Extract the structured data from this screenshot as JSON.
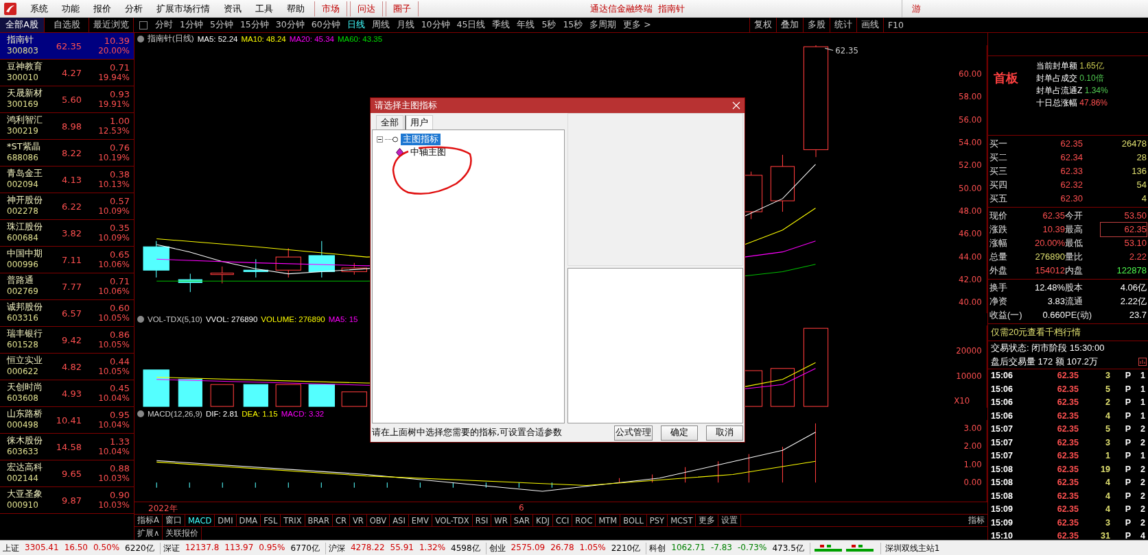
{
  "menu_bar": {
    "items": [
      "系统",
      "功能",
      "报价",
      "分析",
      "扩展市场行情",
      "资讯",
      "工具",
      "帮助"
    ],
    "quick_buttons": [
      "市场",
      "问达",
      "圈子"
    ],
    "title": "通达信金融终端  指南针",
    "right_button": "游"
  },
  "list_tabs": [
    {
      "label": "全部A股",
      "selected": true
    },
    {
      "label": "自选股",
      "selected": false
    },
    {
      "label": "最近浏览",
      "selected": false
    }
  ],
  "period_tabs": [
    {
      "label": "分时",
      "selected": false
    },
    {
      "label": "1分钟",
      "selected": false
    },
    {
      "label": "5分钟",
      "selected": false
    },
    {
      "label": "15分钟",
      "selected": false
    },
    {
      "label": "30分钟",
      "selected": false
    },
    {
      "label": "60分钟",
      "selected": false
    },
    {
      "label": "日线",
      "selected": true
    },
    {
      "label": "周线",
      "selected": false
    },
    {
      "label": "月线",
      "selected": false
    },
    {
      "label": "10分钟",
      "selected": false
    },
    {
      "label": "45日线",
      "selected": false
    },
    {
      "label": "季线",
      "selected": false
    },
    {
      "label": "年线",
      "selected": false
    },
    {
      "label": "5秒",
      "selected": false
    },
    {
      "label": "15秒",
      "selected": false
    },
    {
      "label": "多周期",
      "selected": false
    },
    {
      "label": "更多 >",
      "selected": false
    }
  ],
  "tool_buttons": [
    "复权",
    "叠加",
    "多股",
    "统计",
    "画线",
    "F10"
  ],
  "stocks": [
    {
      "name": "指南针",
      "code": "300803",
      "price": "62.35",
      "change": "10.39",
      "pct": "20.00%",
      "selected": true
    },
    {
      "name": "豆神教育",
      "code": "300010",
      "price": "4.27",
      "change": "0.71",
      "pct": "19.94%",
      "selected": false
    },
    {
      "name": "天晟新材",
      "code": "300169",
      "price": "5.60",
      "change": "0.93",
      "pct": "19.91%",
      "selected": false
    },
    {
      "name": "鸿利智汇",
      "code": "300219",
      "price": "8.98",
      "change": "1.00",
      "pct": "12.53%",
      "selected": false
    },
    {
      "name": "*ST紫晶",
      "code": "688086",
      "price": "8.22",
      "change": "0.76",
      "pct": "10.19%",
      "selected": false
    },
    {
      "name": "青岛金王",
      "code": "002094",
      "price": "4.13",
      "change": "0.38",
      "pct": "10.13%",
      "selected": false
    },
    {
      "name": "神开股份",
      "code": "002278",
      "price": "6.22",
      "change": "0.57",
      "pct": "10.09%",
      "selected": false
    },
    {
      "name": "珠江股份",
      "code": "600684",
      "price": "3.82",
      "change": "0.35",
      "pct": "10.09%",
      "selected": false
    },
    {
      "name": "中国中期",
      "code": "000996",
      "price": "7.11",
      "change": "0.65",
      "pct": "10.06%",
      "selected": false
    },
    {
      "name": "普路通",
      "code": "002769",
      "price": "7.77",
      "change": "0.71",
      "pct": "10.06%",
      "selected": false
    },
    {
      "name": "诚邦股份",
      "code": "603316",
      "price": "6.57",
      "change": "0.60",
      "pct": "10.05%",
      "selected": false
    },
    {
      "name": "瑞丰银行",
      "code": "601528",
      "price": "9.42",
      "change": "0.86",
      "pct": "10.05%",
      "selected": false
    },
    {
      "name": "恒立实业",
      "code": "000622",
      "price": "4.82",
      "change": "0.44",
      "pct": "10.05%",
      "selected": false
    },
    {
      "name": "天创时尚",
      "code": "603608",
      "price": "4.93",
      "change": "0.45",
      "pct": "10.04%",
      "selected": false
    },
    {
      "name": "山东路桥",
      "code": "000498",
      "price": "10.41",
      "change": "0.95",
      "pct": "10.04%",
      "selected": false
    },
    {
      "name": "徕木股份",
      "code": "603633",
      "price": "14.58",
      "change": "1.33",
      "pct": "10.04%",
      "selected": false
    },
    {
      "name": "宏达高科",
      "code": "002144",
      "price": "9.65",
      "change": "0.88",
      "pct": "10.03%",
      "selected": false
    },
    {
      "name": "大亚圣象",
      "code": "000910",
      "price": "9.87",
      "change": "0.90",
      "pct": "10.03%",
      "selected": false
    }
  ],
  "chart": {
    "main_header": [
      {
        "text": "指南针(日线)"
      },
      {
        "text": "MA5: 52.24",
        "color": "#ffffff"
      },
      {
        "text": "MA10: 48.24",
        "color": "#ffff00"
      },
      {
        "text": "MA20: 45.34",
        "color": "#ff00ff"
      },
      {
        "text": "MA60: 43.35",
        "color": "#00e000"
      }
    ],
    "price_labels": [
      "60.00",
      "58.00",
      "56.00",
      "54.00",
      "52.00",
      "50.00",
      "48.00",
      "46.00",
      "44.00",
      "42.00",
      "40.00"
    ],
    "high_label": "62.35",
    "volume_header": [
      {
        "text": "VOL-TDX(5,10)"
      },
      {
        "text": "VVOL: 276890",
        "color": "#ffffff"
      },
      {
        "text": "VOLUME: 276890",
        "color": "#ffff00"
      },
      {
        "text": "MA5: 15",
        "color": "#ff00ff"
      }
    ],
    "volume_labels": [
      "20000",
      "10000",
      "X10"
    ],
    "macd_header": [
      {
        "text": "MACD(12,26,9)"
      },
      {
        "text": "DIF: 2.81",
        "color": "#ffffff"
      },
      {
        "text": "DEA: 1.15",
        "color": "#ffff00"
      },
      {
        "text": "MACD: 3.32",
        "color": "#ff00ff"
      }
    ],
    "macd_labels": [
      "3.00",
      "2.00",
      "1.00",
      "0.00"
    ],
    "date_labels": [
      "2022年",
      "6"
    ]
  },
  "indicator_tabs": [
    {
      "label": "指标A",
      "selected": false
    },
    {
      "label": "窗口",
      "selected": false
    },
    {
      "label": "MACD",
      "selected": true
    },
    {
      "label": "DMI",
      "selected": false
    },
    {
      "label": "DMA",
      "selected": false
    },
    {
      "label": "FSL",
      "selected": false
    },
    {
      "label": "TRIX",
      "selected": false
    },
    {
      "label": "BRAR",
      "selected": false
    },
    {
      "label": "CR",
      "selected": false
    },
    {
      "label": "VR",
      "selected": false
    },
    {
      "label": "OBV",
      "selected": false
    },
    {
      "label": "ASI",
      "selected": false
    },
    {
      "label": "EMV",
      "selected": false
    },
    {
      "label": "VOL-TDX",
      "selected": false
    },
    {
      "label": "RSI",
      "selected": false
    },
    {
      "label": "WR",
      "selected": false
    },
    {
      "label": "SAR",
      "selected": false
    },
    {
      "label": "KDJ",
      "selected": false
    },
    {
      "label": "CCI",
      "selected": false
    },
    {
      "label": "ROC",
      "selected": false
    },
    {
      "label": "MTM",
      "selected": false
    },
    {
      "label": "BOLL",
      "selected": false
    },
    {
      "label": "PSY",
      "selected": false
    },
    {
      "label": "MCST",
      "selected": false
    },
    {
      "label": "更多",
      "selected": false
    },
    {
      "label": "设置",
      "selected": false
    }
  ],
  "indicator_right": "指标",
  "extension_tabs": [
    "扩展∧",
    "关联报价"
  ],
  "dialog": {
    "title": "请选择主图指标",
    "tabs": [
      {
        "label": "全部",
        "selected": false
      },
      {
        "label": "用户",
        "selected": true
      }
    ],
    "tree": [
      {
        "label": "主图指标",
        "expanded": true,
        "selected": true,
        "children": [
          {
            "label": "中轴主图",
            "selected": false
          }
        ]
      }
    ],
    "hint": "请在上面树中选择您需要的指标,可设置合适参数",
    "buttons": [
      "公式管理",
      "确定",
      "取消"
    ]
  },
  "quote": {
    "badge": "首板",
    "seal_info": [
      {
        "label": "当前封单额",
        "value": "1.65亿",
        "color": "#c8c850"
      },
      {
        "label": "封单占成交",
        "value": "0.10倍",
        "color": "#50c850"
      },
      {
        "label": "封单占流通Z",
        "value": "1.34%",
        "color": "#50c850"
      },
      {
        "label": "十日总涨幅",
        "value": "47.86%",
        "color": "#ff5050"
      }
    ],
    "bids": [
      {
        "label": "买一",
        "price": "62.35",
        "volume": "26478"
      },
      {
        "label": "买二",
        "price": "62.34",
        "volume": "28"
      },
      {
        "label": "买三",
        "price": "62.33",
        "volume": "136"
      },
      {
        "label": "买四",
        "price": "62.32",
        "volume": "54"
      },
      {
        "label": "买五",
        "price": "62.30",
        "volume": "4"
      }
    ],
    "stats": [
      {
        "label": "现价",
        "value": "62.35",
        "color": "#ff5050"
      },
      {
        "label": "今开",
        "value": "53.50",
        "color": "#ff5050"
      },
      {
        "label": "涨跌",
        "value": "10.39",
        "color": "#ff5050"
      },
      {
        "label": "最高",
        "value": "62.35",
        "color": "#ff5050"
      },
      {
        "label": "涨幅",
        "value": "20.00%",
        "color": "#ff5050"
      },
      {
        "label": "最低",
        "value": "53.10",
        "color": "#ff5050"
      },
      {
        "label": "总量",
        "value": "276890",
        "color": "#e0e070"
      },
      {
        "label": "量比",
        "value": "2.22",
        "color": "#ff5050"
      },
      {
        "label": "外盘",
        "value": "154012",
        "color": "#ff5050"
      },
      {
        "label": "内盘",
        "value": "122878",
        "color": "#50ff50"
      }
    ],
    "finance": [
      {
        "label": "换手",
        "value": "12.48%"
      },
      {
        "label": "股本",
        "value": "4.06亿"
      },
      {
        "label": "净资",
        "value": "3.83"
      },
      {
        "label": "流通",
        "value": "2.22亿"
      },
      {
        "label": "收益(一)",
        "value": "0.660"
      },
      {
        "label": "PE(动)",
        "value": "23.7"
      }
    ],
    "promo": "仅需20元查看千档行情",
    "status_line": "交易状态: 闭市阶段 15:30:00",
    "after_hours": "盘后交易量 172 额 107.2万",
    "ticks": [
      {
        "time": "15:06",
        "price": "62.35",
        "volume": "3",
        "flag": "P",
        "count": "1"
      },
      {
        "time": "15:06",
        "price": "62.35",
        "volume": "5",
        "flag": "P",
        "count": "1"
      },
      {
        "time": "15:06",
        "price": "62.35",
        "volume": "2",
        "flag": "P",
        "count": "1"
      },
      {
        "time": "15:06",
        "price": "62.35",
        "volume": "4",
        "flag": "P",
        "count": "1"
      },
      {
        "time": "15:07",
        "price": "62.35",
        "volume": "5",
        "flag": "P",
        "count": "2"
      },
      {
        "time": "15:07",
        "price": "62.35",
        "volume": "3",
        "flag": "P",
        "count": "2"
      },
      {
        "time": "15:07",
        "price": "62.35",
        "volume": "1",
        "flag": "P",
        "count": "1"
      },
      {
        "time": "15:08",
        "price": "62.35",
        "volume": "19",
        "flag": "P",
        "count": "2"
      },
      {
        "time": "15:08",
        "price": "62.35",
        "volume": "4",
        "flag": "P",
        "count": "2"
      },
      {
        "time": "15:08",
        "price": "62.35",
        "volume": "4",
        "flag": "P",
        "count": "2"
      },
      {
        "time": "15:09",
        "price": "62.35",
        "volume": "4",
        "flag": "P",
        "count": "2"
      },
      {
        "time": "15:09",
        "price": "62.35",
        "volume": "3",
        "flag": "P",
        "count": "2"
      },
      {
        "time": "15:10",
        "price": "62.35",
        "volume": "31",
        "flag": "P",
        "count": "4"
      }
    ]
  },
  "status_bar": {
    "indices": [
      {
        "name": "上证",
        "value": "3305.41",
        "change": "16.50",
        "pct": "0.50%",
        "amount": "6220亿",
        "color": "#d00000"
      },
      {
        "name": "深证",
        "value": "12137.8",
        "change": "113.97",
        "pct": "0.95%",
        "amount": "6770亿",
        "color": "#d00000"
      },
      {
        "name": "沪深",
        "value": "4278.22",
        "change": "55.91",
        "pct": "1.32%",
        "amount": "4598亿",
        "color": "#d00000"
      },
      {
        "name": "创业",
        "value": "2575.09",
        "change": "26.78",
        "pct": "1.05%",
        "amount": "2210亿",
        "color": "#d00000"
      },
      {
        "name": "科创",
        "value": "1062.71",
        "change": "-7.83",
        "pct": "-0.73%",
        "amount": "473.5亿",
        "color": "#008000"
      }
    ],
    "server": "深圳双线主站1"
  }
}
